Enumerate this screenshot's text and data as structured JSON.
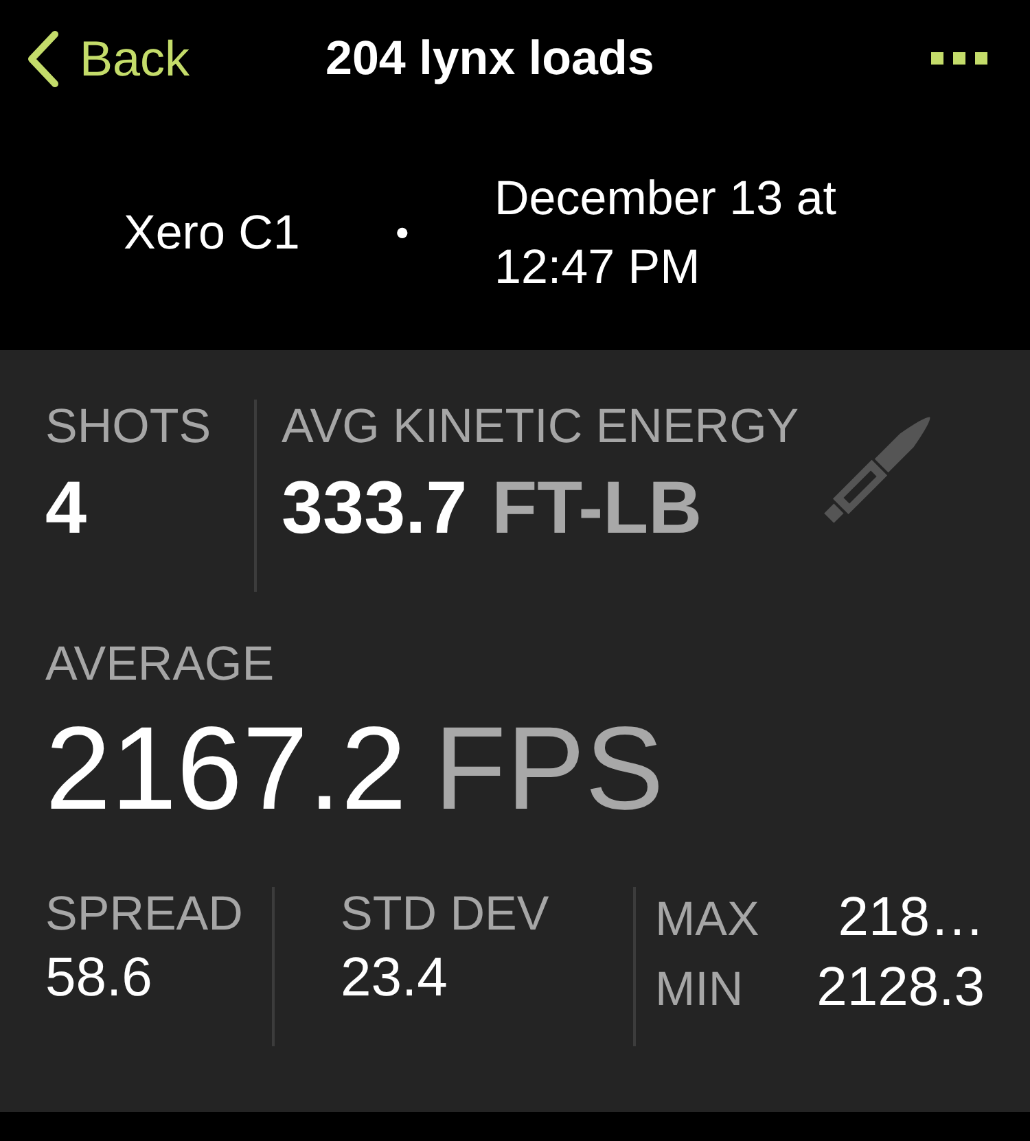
{
  "nav": {
    "back": "Back",
    "title": "204 lynx loads"
  },
  "session": {
    "device": "Xero C1",
    "separator": "•",
    "date": "December 13 at 12:47 PM"
  },
  "shots": {
    "label": "SHOTS",
    "value": "4"
  },
  "kinetic_energy": {
    "label": "AVG KINETIC ENERGY",
    "value": "333.7",
    "unit": "FT-LB"
  },
  "average": {
    "label": "AVERAGE",
    "value": "2167.2",
    "unit": "FPS"
  },
  "stats": [
    {
      "label": "SPREAD",
      "value": "58.6"
    },
    {
      "label": "STD DEV",
      "value": "23.4"
    }
  ],
  "range": [
    {
      "label": "MAX",
      "value": "218…"
    },
    {
      "label": "MIN",
      "value": "2128.3"
    }
  ]
}
